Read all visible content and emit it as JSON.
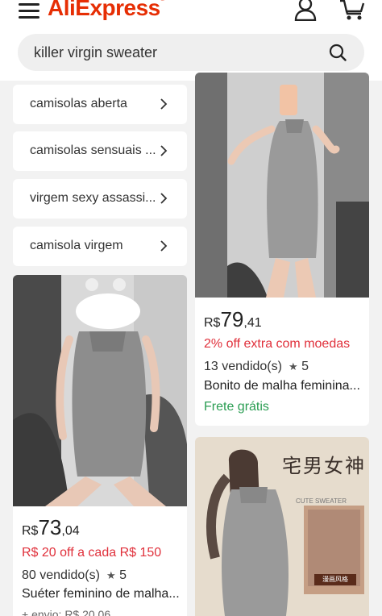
{
  "header": {
    "logo": "AliExpress",
    "logo_mark": "®",
    "brand_color": "#e62e04"
  },
  "search": {
    "query": "killer virgin sweater"
  },
  "icons": {
    "menu": "hamburger-menu-icon",
    "account": "user-icon",
    "cart": "cart-icon",
    "search": "search-icon"
  },
  "suggestions": [
    {
      "label": "camisolas aberta"
    },
    {
      "label": "camisolas sensuais ..."
    },
    {
      "label": "virgem sexy assassi..."
    },
    {
      "label": "camisola virgem"
    }
  ],
  "products": [
    {
      "currency": "R$",
      "price_int": "73",
      "price_dec": ",04",
      "promo": "R$ 20 off a cada R$ 150",
      "sold": "80 vendido(s)",
      "rating": "5",
      "title": "Suéter feminino de malha...",
      "shipping_partial": "+ envio: R$ 20,06"
    },
    {
      "currency": "R$",
      "price_int": "79",
      "price_dec": ",41",
      "promo": "2% off extra com moedas",
      "sold": "13 vendido(s)",
      "rating": "5",
      "title": "Bonito de malha feminina...",
      "shipping": "Frete grátis"
    },
    {
      "banner_cn": "宅男女神",
      "banner_en": "CUTE SWEATER",
      "badge": "漫画风格"
    }
  ],
  "colors": {
    "promo": "#e0303b",
    "free_shipping": "#2a9d52"
  }
}
